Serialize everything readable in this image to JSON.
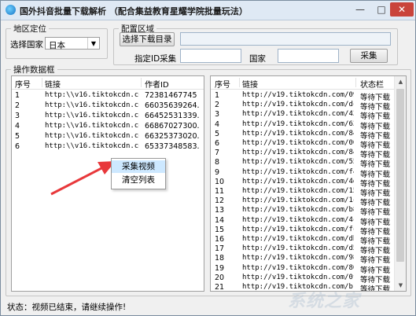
{
  "window": {
    "title": "国外抖音批量下载解析 （配合集益教育星耀学院批量玩法）",
    "min_glyph": "—",
    "max_glyph": "□",
    "close_glyph": "✕"
  },
  "region": {
    "legend": "地区定位",
    "country_label": "选择国家",
    "country_value": "日本"
  },
  "config": {
    "legend": "配置区域",
    "choose_dir_label": "选择下载目录",
    "dir_value": "",
    "id_label": "指定ID采集",
    "id_value": "",
    "country_label": "国家",
    "country_value": "",
    "collect_label": "采集"
  },
  "data_group": {
    "legend": "操作数据框"
  },
  "left_list": {
    "headers": [
      "序号",
      "链接",
      "作者ID"
    ],
    "rows": [
      {
        "no": "1",
        "link": "http:\\\\v16.tiktokcdn.co...",
        "author": "72381467745"
      },
      {
        "no": "2",
        "link": "http:\\\\v16.tiktokcdn.co...",
        "author": "66035639264..."
      },
      {
        "no": "3",
        "link": "http:\\\\v16.tiktokcdn.co...",
        "author": "66452531339..."
      },
      {
        "no": "4",
        "link": "http:\\\\v16.tiktokcdn.co...",
        "author": "66867027300..."
      },
      {
        "no": "5",
        "link": "http:\\\\v16.tiktokcdn.co...",
        "author": "66325373020..."
      },
      {
        "no": "6",
        "link": "http:\\\\v16.tiktokcdn.co...",
        "author": "65337348583..."
      }
    ]
  },
  "context_menu": {
    "items": [
      "采集视频",
      "清空列表"
    ]
  },
  "right_list": {
    "headers": [
      "序号",
      "链接",
      "状态栏"
    ],
    "rows": [
      {
        "no": "1",
        "link": "http://v19.tiktokcdn.com/092...",
        "status": "等待下载"
      },
      {
        "no": "2",
        "link": "http://v19.tiktokcdn.com/dc1...",
        "status": "等待下载"
      },
      {
        "no": "3",
        "link": "http://v19.tiktokcdn.com/437...",
        "status": "等待下载"
      },
      {
        "no": "4",
        "link": "http://v19.tiktokcdn.com/633...",
        "status": "等待下载"
      },
      {
        "no": "5",
        "link": "http://v19.tiktokcdn.com/847...",
        "status": "等待下载"
      },
      {
        "no": "6",
        "link": "http://v19.tiktokcdn.com/004...",
        "status": "等待下载"
      },
      {
        "no": "7",
        "link": "http://v19.tiktokcdn.com/84f...",
        "status": "等待下载"
      },
      {
        "no": "8",
        "link": "http://v19.tiktokcdn.com/553...",
        "status": "等待下载"
      },
      {
        "no": "9",
        "link": "http://v19.tiktokcdn.com/f49...",
        "status": "等待下载"
      },
      {
        "no": "10",
        "link": "http://v19.tiktokcdn.com/4d2...",
        "status": "等待下载"
      },
      {
        "no": "11",
        "link": "http://v19.tiktokcdn.com/15a...",
        "status": "等待下载"
      },
      {
        "no": "12",
        "link": "http://v19.tiktokcdn.com/1c3...",
        "status": "等待下载"
      },
      {
        "no": "13",
        "link": "http://v19.tiktokcdn.com/b85...",
        "status": "等待下载"
      },
      {
        "no": "14",
        "link": "http://v19.tiktokcdn.com/4cd...",
        "status": "等待下载"
      },
      {
        "no": "15",
        "link": "http://v19.tiktokcdn.com/fc7...",
        "status": "等待下载"
      },
      {
        "no": "16",
        "link": "http://v19.tiktokcdn.com/db2...",
        "status": "等待下载"
      },
      {
        "no": "17",
        "link": "http://v19.tiktokcdn.com/d5a...",
        "status": "等待下载"
      },
      {
        "no": "18",
        "link": "http://v19.tiktokcdn.com/98e...",
        "status": "等待下载"
      },
      {
        "no": "19",
        "link": "http://v19.tiktokcdn.com/808...",
        "status": "等待下载"
      },
      {
        "no": "20",
        "link": "http://v19.tiktokcdn.com/0f8...",
        "status": "等待下载"
      },
      {
        "no": "21",
        "link": "http://v19.tiktokcdn.com/b1f...",
        "status": "等待下载"
      }
    ]
  },
  "status_bar": {
    "text": "状态：视频已结束，请继续操作!"
  },
  "colors": {
    "arrow": "#e8383b",
    "titlebar": "#dfe9f4",
    "menu_highlight": "#cde8ff"
  }
}
